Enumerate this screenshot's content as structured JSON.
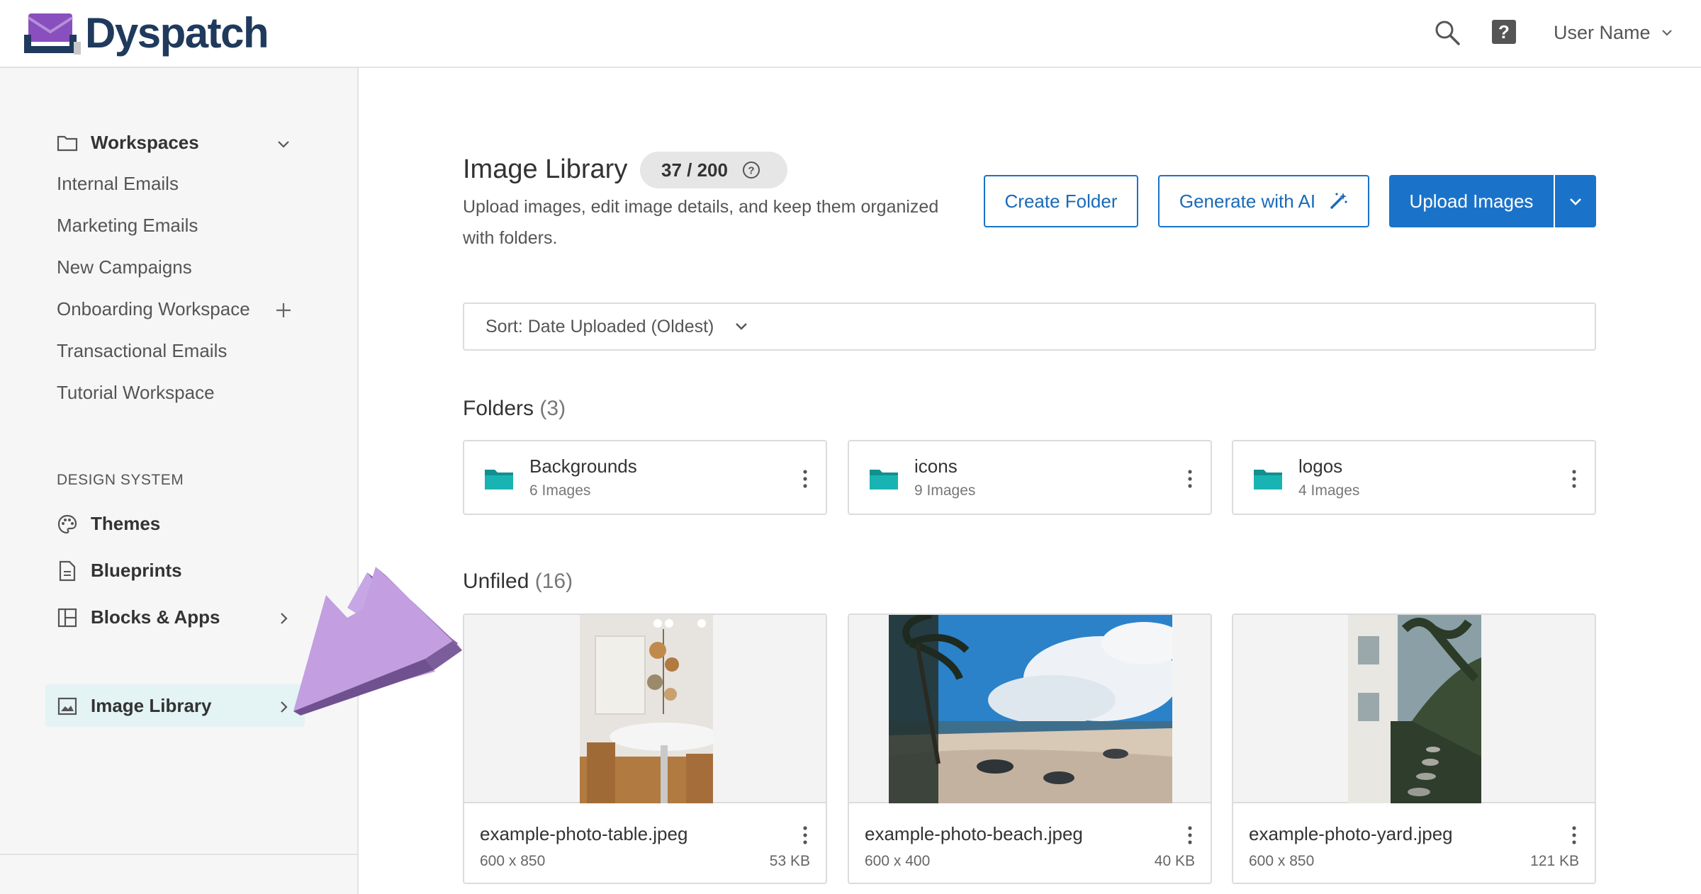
{
  "app": {
    "brand": "Dyspatch",
    "user_name": "User Name"
  },
  "colors": {
    "brand_navy": "#1f3a5c",
    "brand_purple": "#8a4fbf",
    "primary": "#1a73c9",
    "folder_teal": "#1aa6a6",
    "active_bg": "#e4f3f4",
    "arrow_purple": "#b58fd8"
  },
  "sidebar": {
    "workspaces_label": "Workspaces",
    "items": [
      "Internal Emails",
      "Marketing Emails",
      "New Campaigns",
      "Onboarding Workspace",
      "Transactional Emails",
      "Tutorial Workspace"
    ],
    "section_label": "DESIGN SYSTEM",
    "themes": "Themes",
    "blueprints": "Blueprints",
    "blocks": "Blocks & Apps",
    "image_library": "Image Library"
  },
  "main": {
    "title": "Image Library",
    "quota": "37 / 200",
    "subtitle": "Upload images, edit image details, and keep them organized with folders.",
    "create_folder": "Create Folder",
    "generate_ai": "Generate with AI",
    "upload_images": "Upload Images",
    "sort_label": "Sort: Date Uploaded (Oldest)",
    "folders_label": "Folders",
    "folders_count": "(3)",
    "folders": [
      {
        "name": "Backgrounds",
        "count": "6 Images"
      },
      {
        "name": "icons",
        "count": "9 Images"
      },
      {
        "name": "logos",
        "count": "4 Images"
      }
    ],
    "unfiled_label": "Unfiled",
    "unfiled_count": "(16)",
    "images": [
      {
        "name": "example-photo-table.jpeg",
        "dims": "600 x 850",
        "size": "53 KB"
      },
      {
        "name": "example-photo-beach.jpeg",
        "dims": "600 x 400",
        "size": "40 KB"
      },
      {
        "name": "example-photo-yard.jpeg",
        "dims": "600 x 850",
        "size": "121 KB"
      }
    ]
  }
}
